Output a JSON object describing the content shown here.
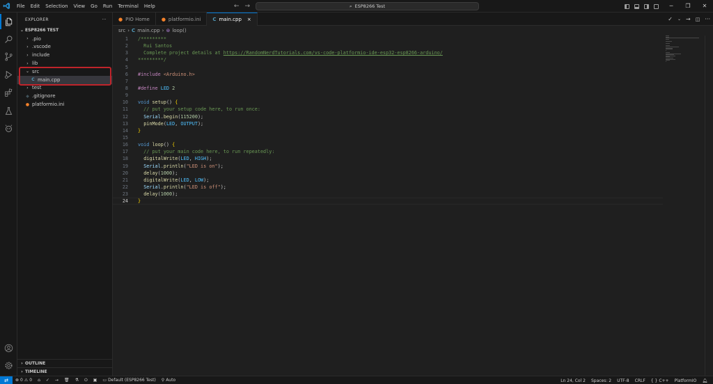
{
  "titlebar": {
    "menu": [
      "File",
      "Edit",
      "Selection",
      "View",
      "Go",
      "Run",
      "Terminal",
      "Help"
    ],
    "search_text": "ESP8266 Test",
    "window_controls": [
      "─",
      "❐",
      "✕"
    ]
  },
  "sidebar": {
    "header": "EXPLORER",
    "more": "···",
    "root": "ESP8266 TEST",
    "tree": [
      {
        "label": ".pio",
        "type": "folder",
        "state": "collapsed",
        "depth": 1
      },
      {
        "label": ".vscode",
        "type": "folder",
        "state": "collapsed",
        "depth": 1
      },
      {
        "label": "include",
        "type": "folder",
        "state": "collapsed",
        "depth": 1
      },
      {
        "label": "lib",
        "type": "folder",
        "state": "collapsed",
        "depth": 1
      },
      {
        "label": "src",
        "type": "folder",
        "state": "expanded",
        "depth": 1
      },
      {
        "label": "main.cpp",
        "type": "cpp",
        "depth": 2,
        "selected": true
      },
      {
        "label": "test",
        "type": "folder",
        "state": "collapsed",
        "depth": 1
      },
      {
        "label": ".gitignore",
        "type": "git",
        "depth": 1
      },
      {
        "label": "platformio.ini",
        "type": "pio",
        "depth": 1
      }
    ],
    "sections": [
      "OUTLINE",
      "TIMELINE"
    ]
  },
  "tabs": [
    {
      "label": "PIO Home",
      "icon": "platformio-icon",
      "active": false
    },
    {
      "label": "platformio.ini",
      "icon": "platformio-icon",
      "active": false
    },
    {
      "label": "main.cpp",
      "icon": "cpp-icon",
      "active": true,
      "close": "×"
    }
  ],
  "breadcrumb": {
    "folder": "src",
    "file": "main.cpp",
    "symbol": "loop()"
  },
  "code": [
    [
      [
        "/*********",
        "comment"
      ]
    ],
    [
      [
        "  Rui Santos",
        "comment"
      ]
    ],
    [
      [
        "  Complete project details at ",
        "comment"
      ],
      [
        "https://RandomNerdTutorials.com/vs-code-platformio-ide-esp32-esp8266-arduino/",
        "link"
      ]
    ],
    [
      [
        "*********/",
        "comment"
      ]
    ],
    [],
    [
      [
        "#include ",
        "pre"
      ],
      [
        "<Arduino.h>",
        "str"
      ]
    ],
    [],
    [
      [
        "#define ",
        "pre"
      ],
      [
        "LED ",
        "const"
      ],
      [
        "2",
        "num"
      ]
    ],
    [],
    [
      [
        "void ",
        "kw"
      ],
      [
        "setup",
        "fn"
      ],
      [
        "() ",
        "plain"
      ],
      [
        "{",
        "brace"
      ]
    ],
    [
      [
        "  // put your setup code here, to run once:",
        "comment"
      ]
    ],
    [
      [
        "  ",
        "plain"
      ],
      [
        "Serial",
        "var"
      ],
      [
        ".",
        "plain"
      ],
      [
        "begin",
        "fn"
      ],
      [
        "(",
        "plain"
      ],
      [
        "115200",
        "num"
      ],
      [
        ");",
        "plain"
      ]
    ],
    [
      [
        "  ",
        "plain"
      ],
      [
        "pinMode",
        "fn"
      ],
      [
        "(",
        "plain"
      ],
      [
        "LED",
        "const"
      ],
      [
        ", ",
        "plain"
      ],
      [
        "OUTPUT",
        "const"
      ],
      [
        ");",
        "plain"
      ]
    ],
    [
      [
        "}",
        "brace"
      ]
    ],
    [],
    [
      [
        "void ",
        "kw"
      ],
      [
        "loop",
        "fn"
      ],
      [
        "() ",
        "plain"
      ],
      [
        "{",
        "brace"
      ]
    ],
    [
      [
        "  // put your main code here, to run repeatedly:",
        "comment"
      ]
    ],
    [
      [
        "  ",
        "plain"
      ],
      [
        "digitalWrite",
        "fn"
      ],
      [
        "(",
        "plain"
      ],
      [
        "LED",
        "const"
      ],
      [
        ", ",
        "plain"
      ],
      [
        "HIGH",
        "const"
      ],
      [
        ");",
        "plain"
      ]
    ],
    [
      [
        "  ",
        "plain"
      ],
      [
        "Serial",
        "var"
      ],
      [
        ".",
        "plain"
      ],
      [
        "println",
        "fn"
      ],
      [
        "(",
        "plain"
      ],
      [
        "\"LED is on\"",
        "str"
      ],
      [
        ");",
        "plain"
      ]
    ],
    [
      [
        "  ",
        "plain"
      ],
      [
        "delay",
        "fn"
      ],
      [
        "(",
        "plain"
      ],
      [
        "1000",
        "num"
      ],
      [
        ");",
        "plain"
      ]
    ],
    [
      [
        "  ",
        "plain"
      ],
      [
        "digitalWrite",
        "fn"
      ],
      [
        "(",
        "plain"
      ],
      [
        "LED",
        "const"
      ],
      [
        ", ",
        "plain"
      ],
      [
        "LOW",
        "const"
      ],
      [
        ");",
        "plain"
      ]
    ],
    [
      [
        "  ",
        "plain"
      ],
      [
        "Serial",
        "var"
      ],
      [
        ".",
        "plain"
      ],
      [
        "println",
        "fn"
      ],
      [
        "(",
        "plain"
      ],
      [
        "\"LED is off\"",
        "str"
      ],
      [
        ");",
        "plain"
      ]
    ],
    [
      [
        "  ",
        "plain"
      ],
      [
        "delay",
        "fn"
      ],
      [
        "(",
        "plain"
      ],
      [
        "1000",
        "num"
      ],
      [
        ");",
        "plain"
      ]
    ],
    [
      [
        "}",
        "brace"
      ]
    ]
  ],
  "current_line": 24,
  "statusbar": {
    "errors": "0",
    "warnings": "0",
    "env": "Default (ESP8266 Test)",
    "auto": "Auto",
    "position": "Ln 24, Col 2",
    "spaces": "Spaces: 2",
    "encoding": "UTF-8",
    "eol": "CRLF",
    "language": "C++",
    "platform": "PlatformIO"
  },
  "colors": {
    "accent": "#0078d4",
    "highlight_box": "#c0242b",
    "platformio": "#f5822a",
    "cpp": "#519aba"
  }
}
